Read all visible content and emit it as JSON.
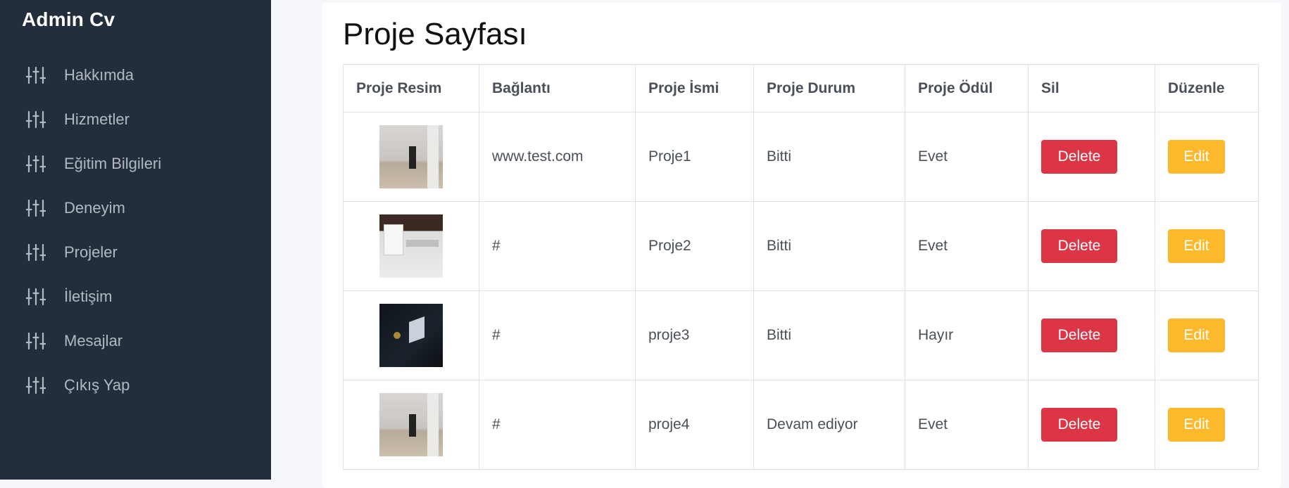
{
  "brand": "Admin Cv",
  "sidebar": {
    "items": [
      {
        "label": "Hakkımda",
        "icon": "sliders-icon"
      },
      {
        "label": "Hizmetler",
        "icon": "sliders-icon"
      },
      {
        "label": "Eğitim Bilgileri",
        "icon": "sliders-icon"
      },
      {
        "label": "Deneyim",
        "icon": "sliders-icon"
      },
      {
        "label": "Projeler",
        "icon": "sliders-icon"
      },
      {
        "label": "İletişim",
        "icon": "sliders-icon"
      },
      {
        "label": "Mesajlar",
        "icon": "sliders-icon"
      },
      {
        "label": "Çıkış Yap",
        "icon": "sliders-icon"
      }
    ]
  },
  "page": {
    "title": "Proje Sayfası"
  },
  "table": {
    "headers": [
      "Proje Resim",
      "Bağlantı",
      "Proje İsmi",
      "Proje Durum",
      "Proje Ödül",
      "Sil",
      "Düzenle"
    ],
    "rows": [
      {
        "link": "www.test.com",
        "name": "Proje1",
        "status": "Bitti",
        "award": "Evet",
        "delete_label": "Delete",
        "edit_label": "Edit"
      },
      {
        "link": "#",
        "name": "Proje2",
        "status": "Bitti",
        "award": "Evet",
        "delete_label": "Delete",
        "edit_label": "Edit"
      },
      {
        "link": "#",
        "name": "proje3",
        "status": "Bitti",
        "award": "Hayır",
        "delete_label": "Delete",
        "edit_label": "Edit"
      },
      {
        "link": "#",
        "name": "proje4",
        "status": "Devam ediyor",
        "award": "Evet",
        "delete_label": "Delete",
        "edit_label": "Edit"
      }
    ]
  },
  "colors": {
    "sidebar_bg": "#222e3c",
    "delete_button": "#dc3545",
    "edit_button": "#fcb92c"
  }
}
